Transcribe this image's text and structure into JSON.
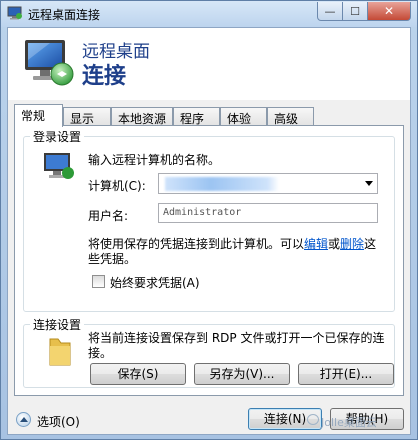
{
  "window": {
    "title": "远程桌面连接",
    "minimize_glyph": "—",
    "maximize_glyph": "☐",
    "close_glyph": "✕"
  },
  "banner": {
    "title": "远程桌面",
    "subtitle": "连接"
  },
  "tabs": [
    {
      "label": "常规",
      "active": true
    },
    {
      "label": "显示",
      "active": false
    },
    {
      "label": "本地资源",
      "active": false
    },
    {
      "label": "程序",
      "active": false
    },
    {
      "label": "体验",
      "active": false
    },
    {
      "label": "高级",
      "active": false
    }
  ],
  "login_group": {
    "title": "登录设置",
    "instruction": "输入远程计算机的名称。",
    "computer_label": "计算机(C):",
    "computer_value": "",
    "username_label": "用户名:",
    "username_value": "Administrator",
    "saved_prefix": "将使用保存的凭据连接到此计算机。可以",
    "edit_link": "编辑",
    "or_text": "或",
    "delete_link": "删除",
    "saved_suffix": "这",
    "saved_line2": "些凭据。",
    "always_ask_label": "始终要求凭据(A)",
    "always_ask_checked": false
  },
  "connection_group": {
    "title": "连接设置",
    "description_line1": "将当前连接设置保存到 RDP 文件或打开一个已保存的连",
    "description_line2": "接。",
    "save_button": "保存(S)",
    "save_as_button": "另存为(V)...",
    "open_button": "打开(E)..."
  },
  "footer": {
    "options_label": "选项(O)",
    "connect_button": "连接(N)",
    "help_button": "帮助(H)",
    "watermark": "Jolle桌面云"
  },
  "colors": {
    "banner_text": "#1e3f8a",
    "link": "#0055cc",
    "close_button": "#c44a36"
  }
}
